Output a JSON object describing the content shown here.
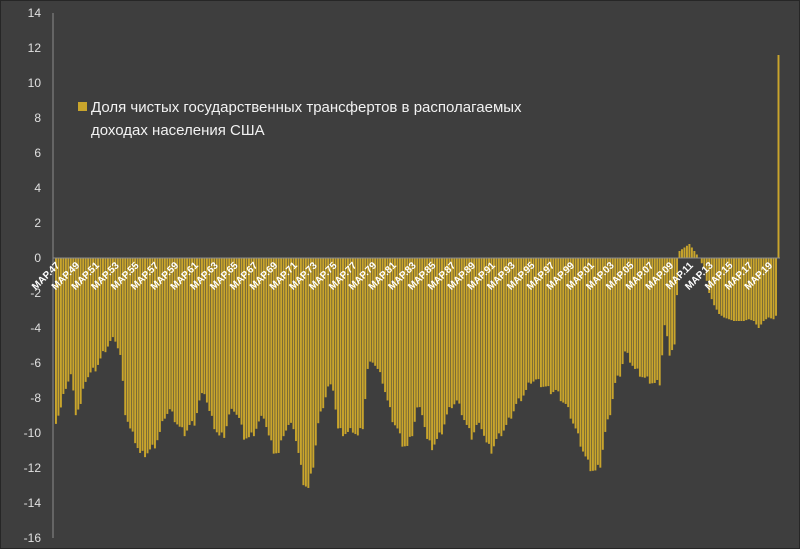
{
  "chart_data": {
    "type": "bar",
    "legend": {
      "lines": [
        "Доля чистых государственных трансфертов в располагаемых",
        "доходах населения США"
      ],
      "placement": "top-left"
    },
    "colors": {
      "bar": "#c9a52c",
      "background": "#3e3e3e",
      "axis": "#8c8c8c",
      "text": "#e0e0e0"
    },
    "ylim": [
      -16,
      14
    ],
    "yticks": [
      14,
      12,
      10,
      8,
      6,
      4,
      2,
      0,
      -2,
      -4,
      -6,
      -8,
      -10,
      -12,
      -14,
      -16
    ],
    "grid": false,
    "x_first": "МАР.47",
    "x_last": "2020",
    "x_step_label": "2 years (quarterly data)",
    "xtick_labels": [
      "МАР.47",
      "МАР.49",
      "МАР.51",
      "МАР.53",
      "МАР.55",
      "МАР.57",
      "МАР.59",
      "МАР.61",
      "МАР.63",
      "МАР.65",
      "МАР.67",
      "МАР.69",
      "МАР.71",
      "МАР.73",
      "МАР.75",
      "МАР.77",
      "МАР.79",
      "МАР.81",
      "МАР.83",
      "МАР.85",
      "МАР.87",
      "МАР.89",
      "МАР.91",
      "МАР.93",
      "МАР.95",
      "МАР.97",
      "МАР.99",
      "МАР.01",
      "МАР.03",
      "МАР.05",
      "МАР.07",
      "МАР.09",
      "МАР.11",
      "МАР.13",
      "МАР.15",
      "МАР.17",
      "МАР.19"
    ],
    "anchors": [
      [
        1947.0,
        -9.3
      ],
      [
        1947.5,
        -8.6
      ],
      [
        1948.0,
        -7.3
      ],
      [
        1948.5,
        -6.7
      ],
      [
        1949.0,
        -8.8
      ],
      [
        1949.5,
        -8.4
      ],
      [
        1950.0,
        -6.9
      ],
      [
        1950.5,
        -6.6
      ],
      [
        1951.0,
        -6.3
      ],
      [
        1951.5,
        -5.8
      ],
      [
        1952.0,
        -5.2
      ],
      [
        1952.5,
        -4.8
      ],
      [
        1953.0,
        -4.6
      ],
      [
        1953.5,
        -5.6
      ],
      [
        1954.0,
        -8.8
      ],
      [
        1954.5,
        -9.8
      ],
      [
        1955.0,
        -10.4
      ],
      [
        1955.5,
        -11.2
      ],
      [
        1956.0,
        -11.2
      ],
      [
        1956.5,
        -11.0
      ],
      [
        1957.0,
        -10.7
      ],
      [
        1957.5,
        -10.0
      ],
      [
        1958.0,
        -9.0
      ],
      [
        1958.5,
        -8.7
      ],
      [
        1959.0,
        -9.2
      ],
      [
        1959.5,
        -9.7
      ],
      [
        1960.0,
        -10.0
      ],
      [
        1960.5,
        -9.6
      ],
      [
        1961.0,
        -9.4
      ],
      [
        1961.5,
        -8.2
      ],
      [
        1962.0,
        -7.6
      ],
      [
        1962.5,
        -8.8
      ],
      [
        1963.0,
        -9.6
      ],
      [
        1963.5,
        -10.2
      ],
      [
        1964.0,
        -10.1
      ],
      [
        1964.5,
        -9.0
      ],
      [
        1965.0,
        -8.6
      ],
      [
        1965.5,
        -9.2
      ],
      [
        1966.0,
        -10.2
      ],
      [
        1966.5,
        -10.3
      ],
      [
        1967.0,
        -10.0
      ],
      [
        1967.5,
        -9.4
      ],
      [
        1968.0,
        -9.0
      ],
      [
        1968.5,
        -10.2
      ],
      [
        1969.0,
        -11.0
      ],
      [
        1969.5,
        -11.2
      ],
      [
        1970.0,
        -10.0
      ],
      [
        1970.5,
        -9.6
      ],
      [
        1971.0,
        -9.6
      ],
      [
        1971.5,
        -11.2
      ],
      [
        1972.0,
        -12.8
      ],
      [
        1972.5,
        -13.2
      ],
      [
        1973.0,
        -11.8
      ],
      [
        1973.5,
        -9.5
      ],
      [
        1974.0,
        -8.4
      ],
      [
        1974.5,
        -7.4
      ],
      [
        1975.0,
        -7.4
      ],
      [
        1975.5,
        -9.8
      ],
      [
        1976.0,
        -10.0
      ],
      [
        1976.5,
        -10.0
      ],
      [
        1977.0,
        -9.8
      ],
      [
        1977.5,
        -10.2
      ],
      [
        1978.0,
        -9.6
      ],
      [
        1978.5,
        -6.4
      ],
      [
        1979.0,
        -5.8
      ],
      [
        1979.5,
        -6.4
      ],
      [
        1980.0,
        -7.0
      ],
      [
        1980.5,
        -8.2
      ],
      [
        1981.0,
        -9.2
      ],
      [
        1981.5,
        -9.8
      ],
      [
        1982.0,
        -10.6
      ],
      [
        1982.5,
        -10.8
      ],
      [
        1983.0,
        -10.0
      ],
      [
        1983.5,
        -8.6
      ],
      [
        1984.0,
        -8.8
      ],
      [
        1984.5,
        -10.4
      ],
      [
        1985.0,
        -10.8
      ],
      [
        1985.5,
        -10.4
      ],
      [
        1986.0,
        -9.9
      ],
      [
        1986.5,
        -9.0
      ],
      [
        1987.0,
        -8.4
      ],
      [
        1987.5,
        -8.2
      ],
      [
        1988.0,
        -8.8
      ],
      [
        1988.5,
        -9.6
      ],
      [
        1989.0,
        -10.2
      ],
      [
        1989.5,
        -9.6
      ],
      [
        1990.0,
        -9.6
      ],
      [
        1990.5,
        -10.6
      ],
      [
        1991.0,
        -11.0
      ],
      [
        1991.5,
        -10.4
      ],
      [
        1992.0,
        -10.0
      ],
      [
        1992.5,
        -9.6
      ],
      [
        1993.0,
        -9.0
      ],
      [
        1993.5,
        -8.4
      ],
      [
        1994.0,
        -8.0
      ],
      [
        1994.5,
        -7.6
      ],
      [
        1995.0,
        -7.0
      ],
      [
        1995.5,
        -7.0
      ],
      [
        1996.0,
        -7.2
      ],
      [
        1996.5,
        -7.4
      ],
      [
        1997.0,
        -7.6
      ],
      [
        1997.5,
        -7.6
      ],
      [
        1998.0,
        -8.0
      ],
      [
        1998.5,
        -8.4
      ],
      [
        1999.0,
        -9.0
      ],
      [
        1999.5,
        -9.8
      ],
      [
        2000.0,
        -10.6
      ],
      [
        2000.5,
        -11.4
      ],
      [
        2001.0,
        -12.0
      ],
      [
        2001.5,
        -12.2
      ],
      [
        2002.0,
        -11.8
      ],
      [
        2002.5,
        -10.0
      ],
      [
        2003.0,
        -8.8
      ],
      [
        2003.5,
        -7.2
      ],
      [
        2004.0,
        -6.6
      ],
      [
        2004.5,
        -5.4
      ],
      [
        2005.0,
        -5.8
      ],
      [
        2005.5,
        -6.4
      ],
      [
        2006.0,
        -6.6
      ],
      [
        2006.5,
        -6.9
      ],
      [
        2007.0,
        -7.0
      ],
      [
        2007.5,
        -7.2
      ],
      [
        2008.0,
        -7.1
      ],
      [
        2008.5,
        -3.9
      ],
      [
        2009.0,
        -5.4
      ],
      [
        2009.5,
        -5.0
      ],
      [
        2010.0,
        0.4
      ],
      [
        2010.5,
        0.6
      ],
      [
        2011.0,
        0.8
      ],
      [
        2011.5,
        0.4
      ],
      [
        2012.0,
        0.0
      ],
      [
        2012.5,
        -0.6
      ],
      [
        2013.0,
        -2.0
      ],
      [
        2013.5,
        -2.7
      ],
      [
        2014.0,
        -3.2
      ],
      [
        2014.5,
        -3.4
      ],
      [
        2015.0,
        -3.5
      ],
      [
        2015.5,
        -3.6
      ],
      [
        2016.0,
        -3.6
      ],
      [
        2016.5,
        -3.6
      ],
      [
        2017.0,
        -3.5
      ],
      [
        2017.5,
        -3.6
      ],
      [
        2018.0,
        -4.0
      ],
      [
        2018.5,
        -3.6
      ],
      [
        2019.0,
        -3.4
      ],
      [
        2019.5,
        -3.5
      ],
      [
        2019.75,
        -3.3
      ],
      [
        2020.0,
        11.6
      ]
    ]
  }
}
